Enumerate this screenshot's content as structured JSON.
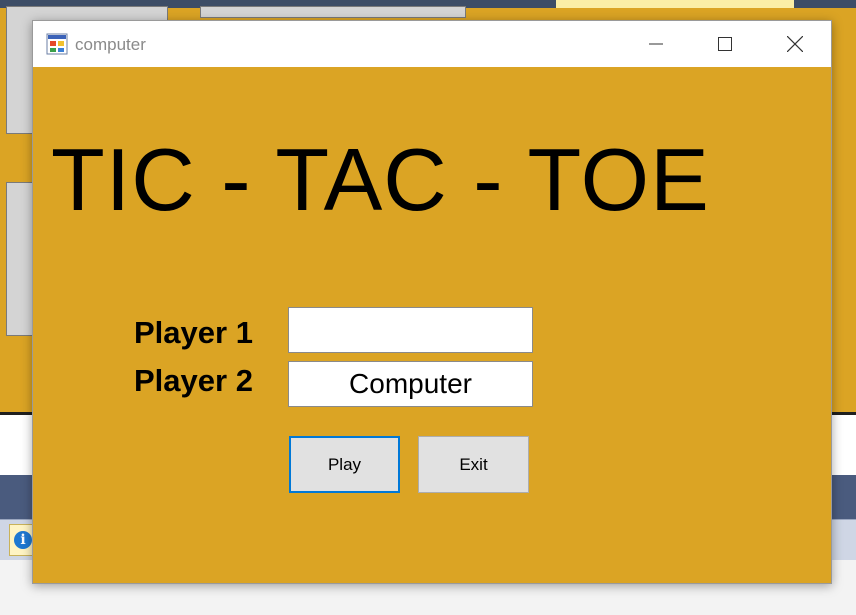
{
  "window": {
    "title": "computer"
  },
  "game": {
    "title": "TIC - TAC - TOE"
  },
  "players": {
    "player1_label": "Player 1",
    "player1_value": "",
    "player2_label": "Player 2",
    "player2_value": "Computer"
  },
  "buttons": {
    "play": "Play",
    "exit": "Exit"
  },
  "icons": {
    "app": "form-app-icon",
    "minimize": "minimize-icon",
    "maximize": "maximize-icon",
    "close": "close-icon",
    "info": "info-icon"
  },
  "colors": {
    "form_background": "#dba424",
    "focus_border": "#0078d7"
  }
}
